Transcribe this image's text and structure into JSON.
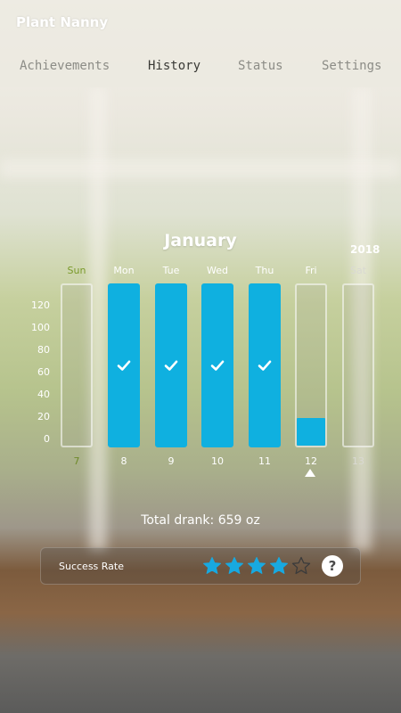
{
  "app": {
    "title": "Plant Nanny"
  },
  "tabs": [
    {
      "label": "Achievements",
      "active": false
    },
    {
      "label": "History",
      "active": true
    },
    {
      "label": "Status",
      "active": false
    },
    {
      "label": "Settings",
      "active": false
    }
  ],
  "calendar": {
    "month": "January",
    "year": "2018",
    "days": [
      {
        "name": "Sun",
        "date": "7",
        "name_color": "#7a9a2a",
        "date_color": "#6f8a2a",
        "percent": 0,
        "checked": false
      },
      {
        "name": "Mon",
        "date": "8",
        "name_color": "#ffffff",
        "date_color": "#ffffff",
        "percent": 100,
        "checked": true
      },
      {
        "name": "Tue",
        "date": "9",
        "name_color": "#ffffff",
        "date_color": "#ffffff",
        "percent": 100,
        "checked": true
      },
      {
        "name": "Wed",
        "date": "10",
        "name_color": "#ffffff",
        "date_color": "#ffffff",
        "percent": 100,
        "checked": true
      },
      {
        "name": "Thu",
        "date": "11",
        "name_color": "#ffffff",
        "date_color": "#ffffff",
        "percent": 100,
        "checked": true
      },
      {
        "name": "Fri",
        "date": "12",
        "name_color": "#ffffff",
        "date_color": "#ffffff",
        "percent": 17,
        "checked": false,
        "selected": true
      },
      {
        "name": "Sat",
        "date": "13",
        "name_color": "#d9d9d2",
        "date_color": "#d9d9d2",
        "percent": 0,
        "checked": false
      }
    ],
    "y_ticks": [
      "120",
      "100",
      "80",
      "60",
      "40",
      "20",
      "0"
    ]
  },
  "summary": {
    "total_label": "Total drank: 659 oz"
  },
  "success_rate": {
    "label": "Success Rate",
    "stars_filled": 4,
    "stars_total": 5,
    "help_icon": "?"
  },
  "colors": {
    "accent": "#0fb0e0",
    "star": "#18a9e0"
  }
}
